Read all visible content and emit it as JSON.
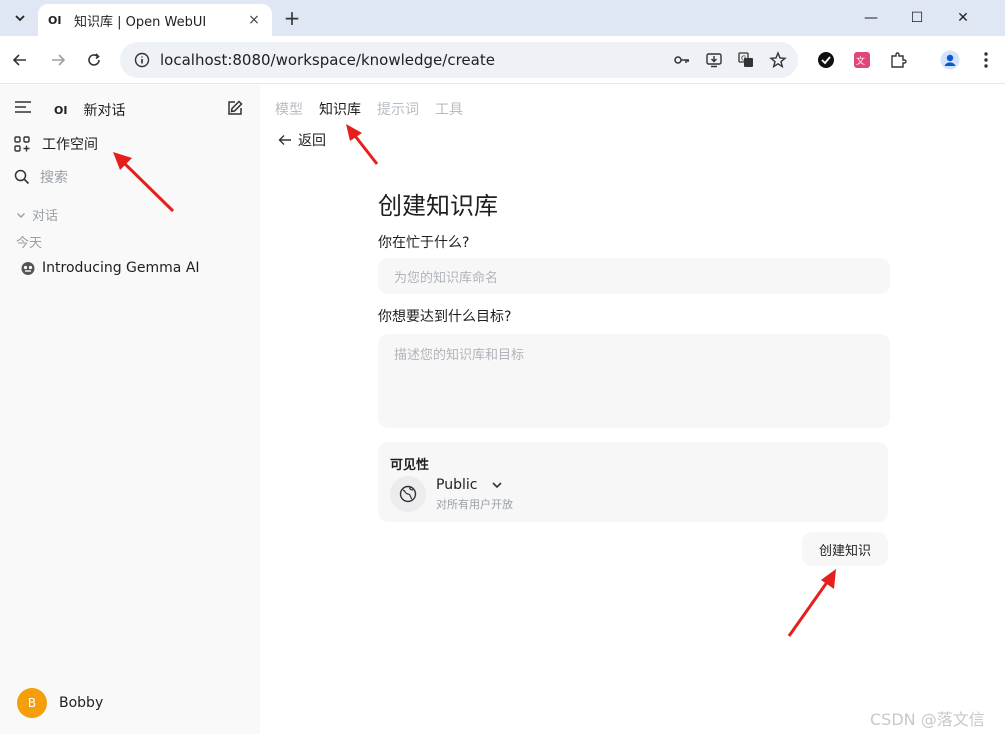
{
  "browser": {
    "tab_favicon": "OI",
    "tab_title": "知识库 | Open WebUI",
    "tab_close": "×",
    "new_tab": "+",
    "url": "localhost:8080/workspace/knowledge/create",
    "window_controls": [
      "—",
      "☐",
      "✕"
    ]
  },
  "sidebar": {
    "logo": "OI",
    "new_chat": "新对话",
    "workspace": "工作空间",
    "search": "搜索",
    "chats_section": "对话",
    "today": "今天",
    "chat_items": [
      "Introducing Gemma AI"
    ],
    "user": {
      "initial": "B",
      "name": "Bobby",
      "avatar_color": "#f59e0b"
    }
  },
  "main": {
    "tabs": [
      {
        "label": "模型",
        "active": false
      },
      {
        "label": "知识库",
        "active": true
      },
      {
        "label": "提示词",
        "active": false
      },
      {
        "label": "工具",
        "active": false
      }
    ],
    "back": "返回",
    "title": "创建知识库",
    "name_label": "你在忙于什么?",
    "name_placeholder": "为您的知识库命名",
    "goal_label": "你想要达到什么目标?",
    "goal_placeholder": "描述您的知识库和目标",
    "visibility": {
      "label": "可见性",
      "value": "Public",
      "description": "对所有用户开放"
    },
    "submit": "创建知识"
  },
  "watermark": "CSDN @落文信",
  "colors": {
    "annotation_arrow": "#e5201c",
    "tabbar": "#dfe7f5"
  }
}
